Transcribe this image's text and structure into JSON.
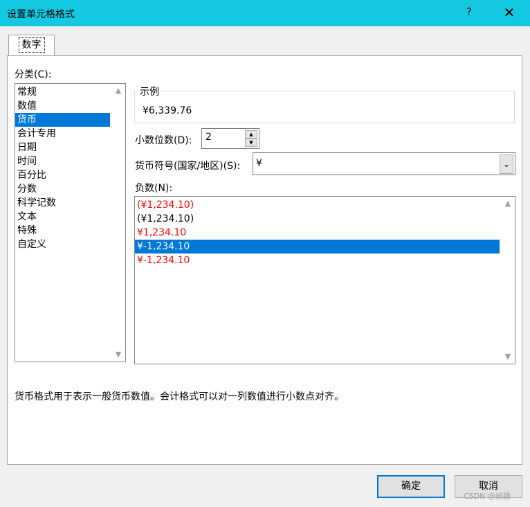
{
  "window": {
    "title": "设置单元格格式",
    "help_glyph": "?",
    "close_glyph": "✕"
  },
  "tabs": [
    {
      "label": "数字",
      "selected": true
    }
  ],
  "category": {
    "label": "分类(C):",
    "items": [
      "常规",
      "数值",
      "货币",
      "会计专用",
      "日期",
      "时间",
      "百分比",
      "分数",
      "科学记数",
      "文本",
      "特殊",
      "自定义"
    ],
    "selected": "货币"
  },
  "sample": {
    "legend": "示例",
    "value": "¥6,339.76"
  },
  "decimal_places": {
    "label": "小数位数(D):",
    "value": "2"
  },
  "currency_symbol": {
    "label": "货币符号(国家/地区)(S):",
    "value": "¥"
  },
  "negative_numbers": {
    "label": "负数(N):",
    "items": [
      {
        "text": "(¥1,234.10)",
        "red": true
      },
      {
        "text": "(¥1,234.10)",
        "red": false
      },
      {
        "text": "¥1,234.10",
        "red": true
      },
      {
        "text": "¥-1,234.10",
        "red": false
      },
      {
        "text": "¥-1,234.10",
        "red": true
      }
    ],
    "selected_index": 3
  },
  "description": "货币格式用于表示一般货币数值。会计格式可以对一列数值进行小数点对齐。",
  "buttons": {
    "ok": "确定",
    "cancel": "取消"
  },
  "watermark": "CSDN @旭猿",
  "colors": {
    "titlebar": "#15c8e2",
    "selection": "#0078d7",
    "negative_red": "#ff0000"
  }
}
